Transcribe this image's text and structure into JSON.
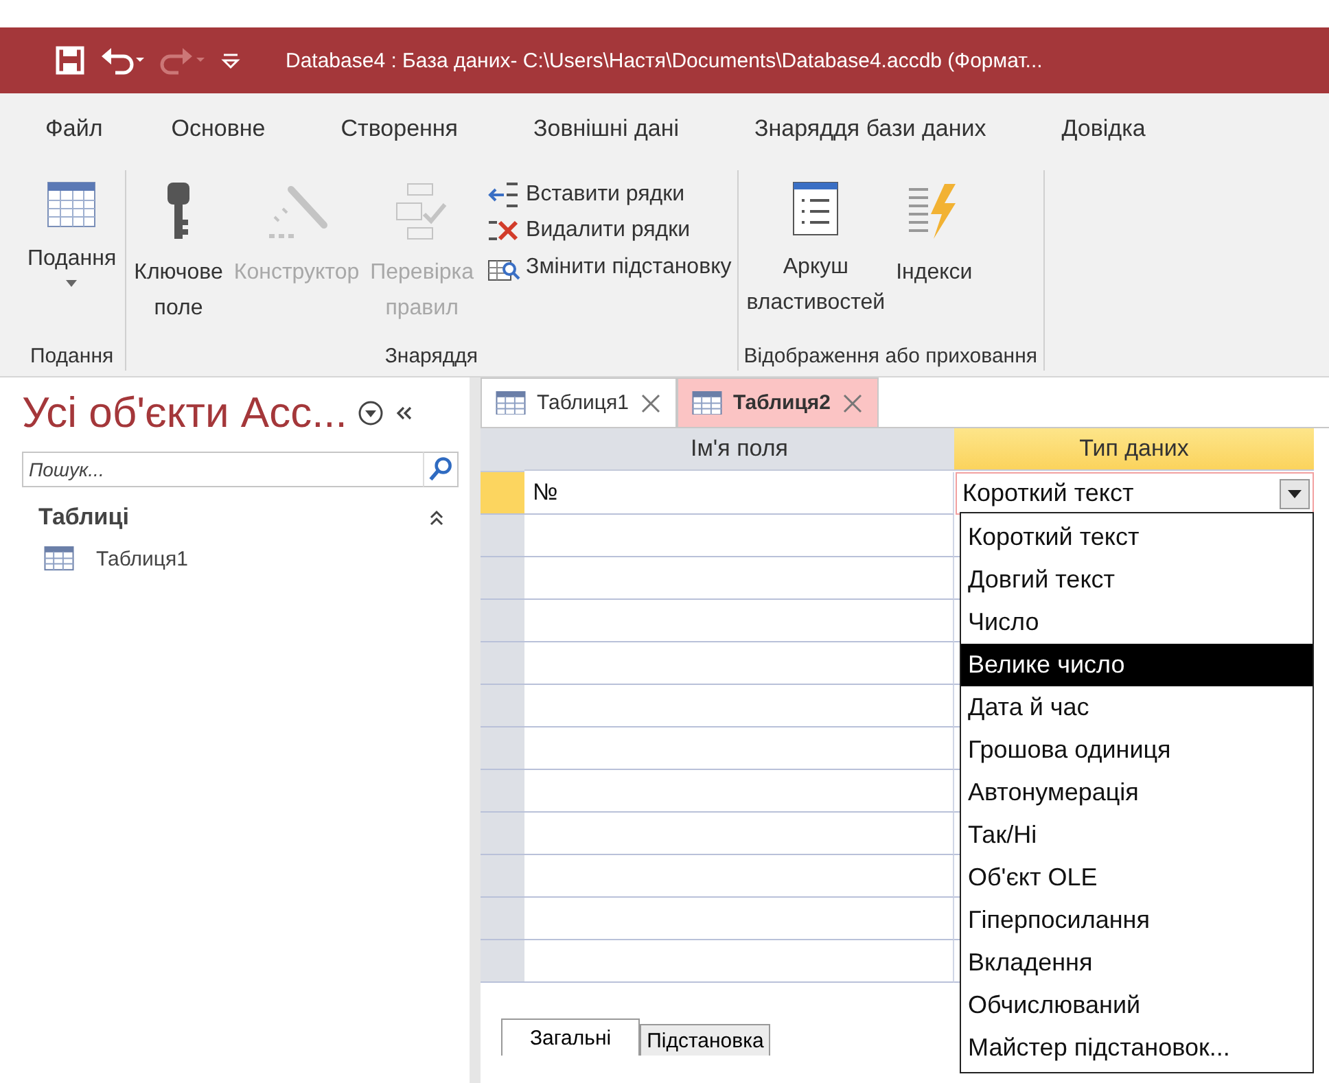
{
  "window": {
    "title": "Database4 : База даних- C:\\Users\\Настя\\Documents\\Database4.accdb (Формат..."
  },
  "menu_tabs": [
    "Файл",
    "Основне",
    "Створення",
    "Зовнішні дані",
    "Знаряддя бази даних",
    "Довідка"
  ],
  "ribbon": {
    "groups": [
      {
        "label": "Подання",
        "buttons": [
          {
            "kind": "large",
            "label": "Подання",
            "disabled": false,
            "has_menu": true
          }
        ]
      },
      {
        "label": "Знаряддя",
        "buttons": [
          {
            "kind": "large",
            "label": "Ключове\nполе",
            "disabled": false
          },
          {
            "kind": "large",
            "label": "Конструктор",
            "disabled": true
          },
          {
            "kind": "large",
            "label": "Перевірка\nправил",
            "disabled": true
          },
          {
            "kind": "small",
            "label": "Вставити рядки",
            "disabled": false
          },
          {
            "kind": "small",
            "label": "Видалити рядки",
            "disabled": false
          },
          {
            "kind": "small",
            "label": "Змінити підстановку",
            "disabled": false
          }
        ]
      },
      {
        "label": "Відображення або приховання",
        "buttons": [
          {
            "kind": "large",
            "label": "Аркуш\nвластивостей",
            "disabled": false
          },
          {
            "kind": "large",
            "label": "Індекси",
            "disabled": false
          }
        ]
      }
    ]
  },
  "nav": {
    "title": "Усі об'єкти Acc...",
    "search": {
      "placeholder": "Пошук..."
    },
    "groups": [
      {
        "label": "Таблиці",
        "expanded": true,
        "items": [
          {
            "label": "Таблиця1"
          }
        ]
      }
    ]
  },
  "document_tabs": [
    {
      "label": "Таблиця1",
      "selected": false
    },
    {
      "label": "Таблиця2",
      "selected": true
    }
  ],
  "table": {
    "columns": [
      {
        "label": "Ім'я поля",
        "selected": false
      },
      {
        "label": "Тип даних",
        "selected": true
      }
    ],
    "rows": [
      {
        "field_name": "№",
        "data_type": "Короткий текст",
        "current": true
      }
    ]
  },
  "dropdown": {
    "options": [
      {
        "label": "Короткий текст",
        "selected": false
      },
      {
        "label": "Довгий текст",
        "selected": false
      },
      {
        "label": "Число",
        "selected": false
      },
      {
        "label": "Велике число",
        "selected": true
      },
      {
        "label": "Дата й час",
        "selected": false
      },
      {
        "label": "Грошова одиниця",
        "selected": false
      },
      {
        "label": "Автонумерація",
        "selected": false
      },
      {
        "label": "Так/Ні",
        "selected": false
      },
      {
        "label": "Об'єкт OLE",
        "selected": false
      },
      {
        "label": "Гіперпосилання",
        "selected": false
      },
      {
        "label": "Вкладення",
        "selected": false
      },
      {
        "label": "Обчислюваний",
        "selected": false
      },
      {
        "label": "Майстер підстановок...",
        "selected": false
      }
    ]
  },
  "bottom_tabs": [
    {
      "label": "Загальні",
      "selected": true
    },
    {
      "label": "Підстановка",
      "selected": false
    }
  ]
}
